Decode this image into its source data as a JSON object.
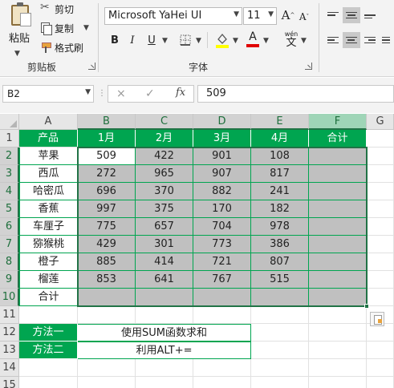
{
  "ribbon": {
    "clipboard": {
      "paste_label": "粘贴",
      "cut_label": "剪切",
      "copy_label": "复制",
      "format_painter_label": "格式刷",
      "group_label": "剪贴板"
    },
    "font": {
      "font_name": "Microsoft YaHei UI",
      "font_size": "11",
      "grow_label": "A",
      "shrink_label": "A",
      "bold_label": "B",
      "italic_label": "I",
      "underline_label": "U",
      "wen_label": "wén",
      "wen_char": "文",
      "font_color_label": "A",
      "fill_color": "#ffff00",
      "font_color": "#e00000",
      "group_label": "字体"
    }
  },
  "formula_bar": {
    "name_box": "B2",
    "cancel_icon": "×",
    "enter_icon": "✓",
    "fx_label": "fx",
    "formula": "509"
  },
  "sheet": {
    "columns": [
      "A",
      "B",
      "C",
      "D",
      "E",
      "F",
      "G"
    ],
    "rows": [
      "1",
      "2",
      "3",
      "4",
      "5",
      "6",
      "7",
      "8",
      "9",
      "10",
      "11",
      "12",
      "13",
      "14",
      "15"
    ],
    "header": [
      "产品",
      "1月",
      "2月",
      "3月",
      "4月",
      "合计"
    ],
    "data": [
      {
        "name": "苹果",
        "values": [
          "509",
          "422",
          "901",
          "108"
        ]
      },
      {
        "name": "西瓜",
        "values": [
          "272",
          "965",
          "907",
          "817"
        ]
      },
      {
        "name": "哈密瓜",
        "values": [
          "696",
          "370",
          "882",
          "241"
        ]
      },
      {
        "name": "香蕉",
        "values": [
          "997",
          "375",
          "170",
          "182"
        ]
      },
      {
        "name": "车厘子",
        "values": [
          "775",
          "657",
          "704",
          "978"
        ]
      },
      {
        "name": "猕猴桃",
        "values": [
          "429",
          "301",
          "773",
          "386"
        ]
      },
      {
        "name": "橙子",
        "values": [
          "885",
          "414",
          "721",
          "807"
        ]
      },
      {
        "name": "榴莲",
        "values": [
          "853",
          "641",
          "767",
          "515"
        ]
      }
    ],
    "total_label": "合计",
    "methods": [
      {
        "label": "方法一",
        "text": "使用SUM函数求和"
      },
      {
        "label": "方法二",
        "text": "利用ALT+="
      }
    ]
  },
  "colors": {
    "header_green": "#00a550",
    "selection_gray": "#c0c0c0",
    "excel_green": "#217346"
  }
}
